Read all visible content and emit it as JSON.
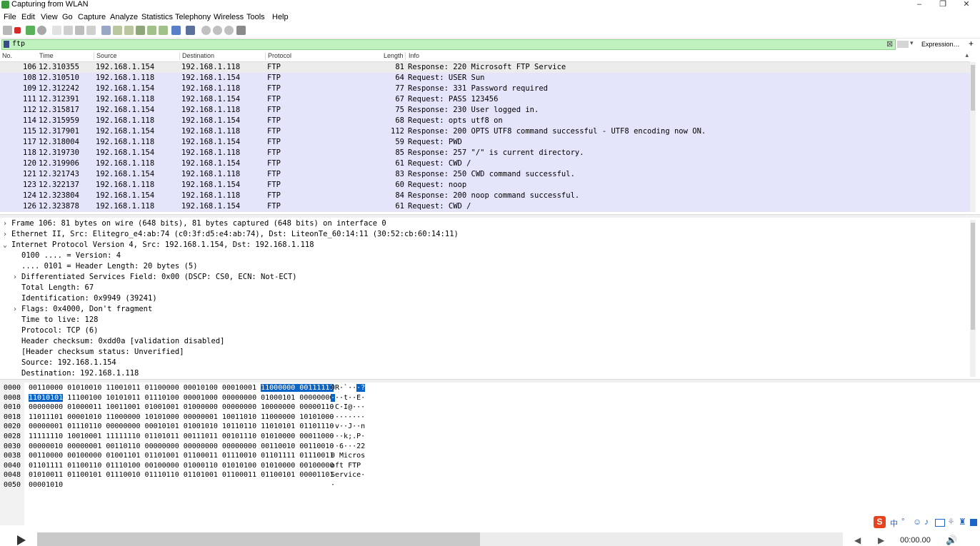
{
  "window": {
    "title": "Capturing from WLAN",
    "controls": [
      "–",
      "❐",
      "✕"
    ]
  },
  "menu": [
    "File",
    "Edit",
    "View",
    "Go",
    "Capture",
    "Analyze",
    "Statistics",
    "Telephony",
    "Wireless",
    "Tools",
    "Help"
  ],
  "filter": {
    "value": "ftp",
    "expression_label": "Expression…",
    "plus": "+"
  },
  "packet_list": {
    "columns": [
      "No.",
      "Time",
      "Source",
      "Destination",
      "Protocol",
      "Length",
      "Info"
    ],
    "rows": [
      {
        "no": "106",
        "time": "12.310355",
        "src": "192.168.1.154",
        "dst": "192.168.1.118",
        "proto": "FTP",
        "len": "81",
        "info": "Response: 220 Microsoft FTP Service"
      },
      {
        "no": "108",
        "time": "12.310510",
        "src": "192.168.1.118",
        "dst": "192.168.1.154",
        "proto": "FTP",
        "len": "64",
        "info": "Request: USER Sun"
      },
      {
        "no": "109",
        "time": "12.312242",
        "src": "192.168.1.154",
        "dst": "192.168.1.118",
        "proto": "FTP",
        "len": "77",
        "info": "Response: 331 Password required"
      },
      {
        "no": "111",
        "time": "12.312391",
        "src": "192.168.1.118",
        "dst": "192.168.1.154",
        "proto": "FTP",
        "len": "67",
        "info": "Request: PASS 123456"
      },
      {
        "no": "112",
        "time": "12.315817",
        "src": "192.168.1.154",
        "dst": "192.168.1.118",
        "proto": "FTP",
        "len": "75",
        "info": "Response: 230 User logged in."
      },
      {
        "no": "114",
        "time": "12.315959",
        "src": "192.168.1.118",
        "dst": "192.168.1.154",
        "proto": "FTP",
        "len": "68",
        "info": "Request: opts utf8 on"
      },
      {
        "no": "115",
        "time": "12.317901",
        "src": "192.168.1.154",
        "dst": "192.168.1.118",
        "proto": "FTP",
        "len": "112",
        "info": "Response: 200 OPTS UTF8 command successful - UTF8 encoding now ON."
      },
      {
        "no": "117",
        "time": "12.318004",
        "src": "192.168.1.118",
        "dst": "192.168.1.154",
        "proto": "FTP",
        "len": "59",
        "info": "Request: PWD"
      },
      {
        "no": "118",
        "time": "12.319730",
        "src": "192.168.1.154",
        "dst": "192.168.1.118",
        "proto": "FTP",
        "len": "85",
        "info": "Response: 257 \"/\" is current directory."
      },
      {
        "no": "120",
        "time": "12.319906",
        "src": "192.168.1.118",
        "dst": "192.168.1.154",
        "proto": "FTP",
        "len": "61",
        "info": "Request: CWD /"
      },
      {
        "no": "121",
        "time": "12.321743",
        "src": "192.168.1.154",
        "dst": "192.168.1.118",
        "proto": "FTP",
        "len": "83",
        "info": "Response: 250 CWD command successful."
      },
      {
        "no": "123",
        "time": "12.322137",
        "src": "192.168.1.118",
        "dst": "192.168.1.154",
        "proto": "FTP",
        "len": "60",
        "info": "Request: noop"
      },
      {
        "no": "124",
        "time": "12.323804",
        "src": "192.168.1.154",
        "dst": "192.168.1.118",
        "proto": "FTP",
        "len": "84",
        "info": "Response: 200 noop command successful."
      },
      {
        "no": "126",
        "time": "12.323878",
        "src": "192.168.1.118",
        "dst": "192.168.1.154",
        "proto": "FTP",
        "len": "61",
        "info": "Request: CWD /"
      }
    ]
  },
  "details": [
    {
      "text": "Frame 106: 81 bytes on wire (648 bits), 81 bytes captured (648 bits) on interface 0",
      "arrow": "›"
    },
    {
      "text": "Ethernet II, Src: Elitegro_e4:ab:74 (c0:3f:d5:e4:ab:74), Dst: LiteonTe_60:14:11 (30:52:cb:60:14:11)",
      "arrow": "›"
    },
    {
      "text": "Internet Protocol Version 4, Src: 192.168.1.154, Dst: 192.168.1.118",
      "arrow": "⌄"
    },
    {
      "text": "0100 .... = Version: 4",
      "arrow": ""
    },
    {
      "text": ".... 0101 = Header Length: 20 bytes (5)",
      "arrow": ""
    },
    {
      "text": "Differentiated Services Field: 0x00 (DSCP: CS0, ECN: Not-ECT)",
      "arrow": "›"
    },
    {
      "text": "Total Length: 67",
      "arrow": ""
    },
    {
      "text": "Identification: 0x9949 (39241)",
      "arrow": ""
    },
    {
      "text": "Flags: 0x4000, Don't fragment",
      "arrow": "›"
    },
    {
      "text": "Time to live: 128",
      "arrow": ""
    },
    {
      "text": "Protocol: TCP (6)",
      "arrow": ""
    },
    {
      "text": "Header checksum: 0xdd0a [validation disabled]",
      "arrow": ""
    },
    {
      "text": "[Header checksum status: Unverified]",
      "arrow": ""
    },
    {
      "text": "Source: 192.168.1.154",
      "arrow": ""
    },
    {
      "text": "Destination: 192.168.1.118",
      "arrow": ""
    }
  ],
  "bytes": [
    {
      "off": "0000",
      "pre": "00110000 01010010 11001011 01100000 00010100 00010001 ",
      "hl": "11000000 00111111",
      "post": "",
      "ascii_pre": "0R·`··",
      "ascii_hl": "·?"
    },
    {
      "off": "0008",
      "pre": "",
      "hl": "11010101",
      "post": " 11100100 10101011 01110100 00001000 00000000 01000101 00000000",
      "ascii_pre": "",
      "ascii_hl": "·",
      "ascii_post": "··t··E·"
    },
    {
      "off": "0010",
      "pre": "00000000 01000011 10011001 01001001 01000000 00000000 10000000 00000110",
      "ascii_pre": "·C·I@···"
    },
    {
      "off": "0018",
      "pre": "11011101 00001010 11000000 10101000 00000001 10011010 11000000 10101000",
      "ascii_pre": "········"
    },
    {
      "off": "0020",
      "pre": "00000001 01110110 00000000 00010101 01001010 10110110 11010101 01101110",
      "ascii_pre": "·v··J··n"
    },
    {
      "off": "0028",
      "pre": "11111110 10010001 11111110 01101011 00111011 00101110 01010000 00011000",
      "ascii_pre": "···k;.P·"
    },
    {
      "off": "0030",
      "pre": "00000010 00000001 00110110 00000000 00000000 00000000 00110010 00110010",
      "ascii_pre": "··6···22"
    },
    {
      "off": "0038",
      "pre": "00110000 00100000 01001101 01101001 01100011 01110010 01101111 01110011",
      "ascii_pre": "0 Micros"
    },
    {
      "off": "0040",
      "pre": "01101111 01100110 01110100 00100000 01000110 01010100 01010000 00100000",
      "ascii_pre": "oft FTP "
    },
    {
      "off": "0048",
      "pre": "01010011 01100101 01110010 01110110 01101001 01100011 01100101 00001101",
      "ascii_pre": "Service·"
    },
    {
      "off": "0050",
      "pre": "00001010",
      "ascii_pre": "·"
    }
  ],
  "player": {
    "time": "00:00.00",
    "progress": 0.55
  },
  "ime": {
    "logo": "S",
    "label": "中"
  },
  "colors": {
    "filter_bg": "#bff2bf",
    "row_bg": "#e4e4fb",
    "selected_row_bg": "#ececec",
    "byte_highlight": "#0a64c8"
  }
}
